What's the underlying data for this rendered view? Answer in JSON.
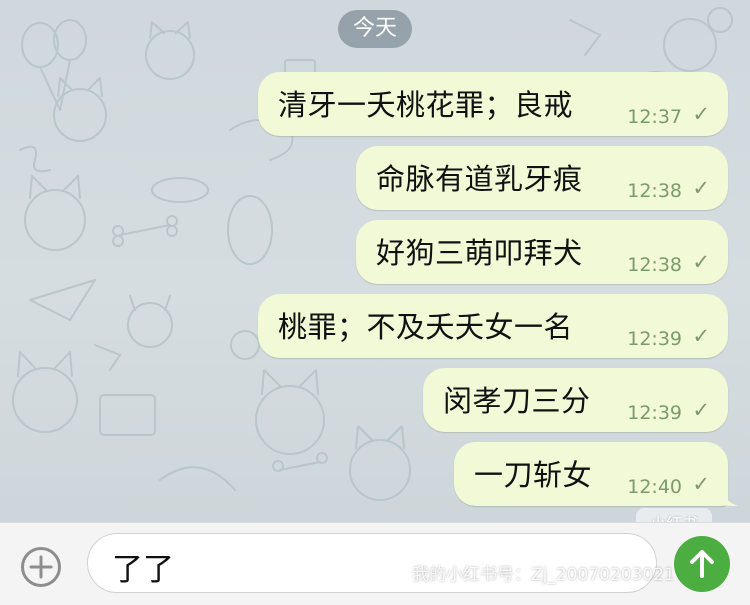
{
  "chat": {
    "date_label": "今天",
    "messages": [
      {
        "text": "清牙一夭桃花罪；良戒",
        "time": "12:37",
        "status": "sent-check"
      },
      {
        "text": "命脉有道乳牙痕",
        "time": "12:38",
        "status": "sent-check"
      },
      {
        "text": "好狗三萌叩拜犬",
        "time": "12:38",
        "status": "sent-check"
      },
      {
        "text": "桃罪；不及夭夭女一名",
        "time": "12:39",
        "status": "sent-check"
      },
      {
        "text": "闵孝刀三分",
        "time": "12:39",
        "status": "sent-check"
      },
      {
        "text": "一刀斩女",
        "time": "12:40",
        "status": "sent-check"
      }
    ]
  },
  "composer": {
    "input_value": "了了",
    "attach_icon": "plus-circle-icon",
    "send_icon": "arrow-up-icon"
  },
  "watermark": {
    "logo_text": "小红书",
    "id_text": "我的小红书号：Zj_20070203021"
  },
  "colors": {
    "bubble": "#f1f9d6",
    "time": "#7d9a6a",
    "send_button": "#4cad41",
    "date_pill": "#7e8e98"
  }
}
